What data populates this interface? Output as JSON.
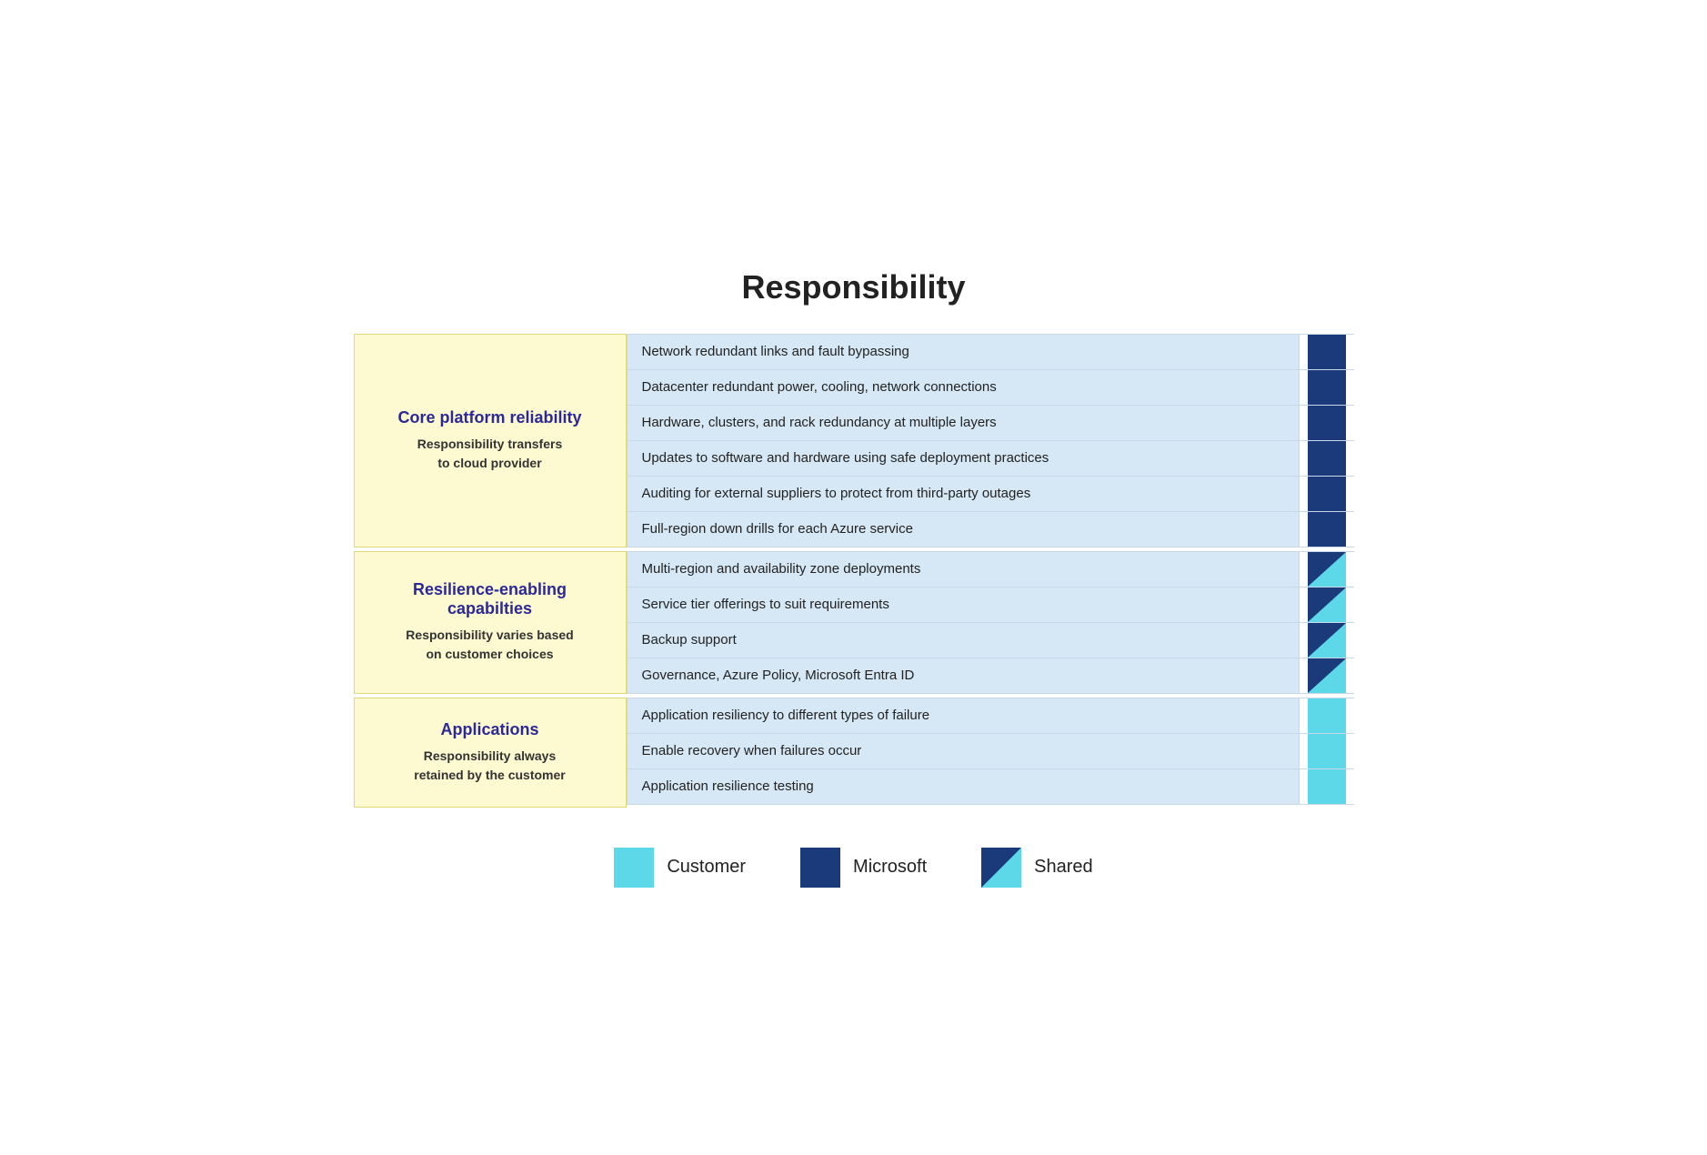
{
  "title": "Responsibility",
  "sections": [
    {
      "id": "core-platform",
      "label_title": "Core platform reliability",
      "label_subtitle": "Responsibility transfers\nto cloud provider",
      "items": [
        {
          "text": "Network redundant links and fault bypassing",
          "indicator": "microsoft"
        },
        {
          "text": "Datacenter redundant power, cooling, network connections",
          "indicator": "microsoft"
        },
        {
          "text": "Hardware, clusters, and rack redundancy at multiple layers",
          "indicator": "microsoft"
        },
        {
          "text": "Updates to software and hardware using safe deployment practices",
          "indicator": "microsoft"
        },
        {
          "text": "Auditing for external suppliers to protect from third-party outages",
          "indicator": "microsoft"
        },
        {
          "text": "Full-region down drills for each Azure service",
          "indicator": "microsoft"
        }
      ]
    },
    {
      "id": "resilience-enabling",
      "label_title": "Resilience-enabling capabilties",
      "label_subtitle": "Responsibility varies based\non customer choices",
      "items": [
        {
          "text": "Multi-region and availability zone deployments",
          "indicator": "shared"
        },
        {
          "text": "Service tier offerings to suit requirements",
          "indicator": "shared"
        },
        {
          "text": "Backup support",
          "indicator": "shared"
        },
        {
          "text": "Governance, Azure Policy, Microsoft Entra ID",
          "indicator": "shared"
        }
      ]
    },
    {
      "id": "applications",
      "label_title": "Applications",
      "label_subtitle": "Responsibility always\nretained by the customer",
      "items": [
        {
          "text": "Application resiliency to different types of failure",
          "indicator": "customer"
        },
        {
          "text": "Enable recovery when failures occur",
          "indicator": "customer"
        },
        {
          "text": "Application resilience testing",
          "indicator": "customer"
        }
      ]
    }
  ],
  "legend": [
    {
      "id": "customer",
      "label": "Customer",
      "type": "customer"
    },
    {
      "id": "microsoft",
      "label": "Microsoft",
      "type": "microsoft"
    },
    {
      "id": "shared",
      "label": "Shared",
      "type": "shared"
    }
  ]
}
